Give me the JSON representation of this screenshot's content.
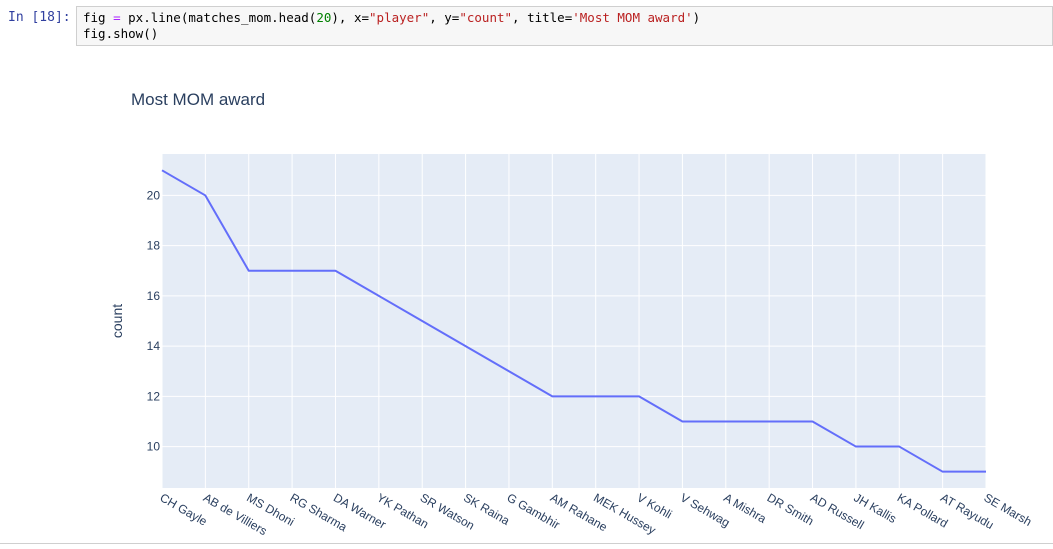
{
  "cell": {
    "prompt": "In [18]:",
    "code": {
      "line1_parts": [
        "fig",
        " = ",
        "px.line(matches_mom.head(",
        "20",
        "), x=",
        "\"player\"",
        ", y=",
        "\"count\"",
        ", title=",
        "'Most MOM award'",
        ")"
      ],
      "line2": "fig.show()"
    }
  },
  "colors": {
    "plot_bg": "#e5ecf6",
    "grid": "#ffffff",
    "line": "#636efa",
    "text": "#2a3f5f",
    "prompt": "#303f9f"
  },
  "chart_data": {
    "type": "line",
    "title": "Most MOM award",
    "xlabel": "",
    "ylabel": "count",
    "x": [
      "CH Gayle",
      "AB de Villiers",
      "MS Dhoni",
      "RG Sharma",
      "DA Warner",
      "YK Pathan",
      "SR Watson",
      "SK Raina",
      "G Gambhir",
      "AM Rahane",
      "MEK Hussey",
      "V Kohli",
      "V Sehwag",
      "A Mishra",
      "DR Smith",
      "AD Russell",
      "JH Kallis",
      "KA Pollard",
      "AT Rayudu",
      "SE Marsh"
    ],
    "y": [
      21,
      20,
      17,
      17,
      17,
      16,
      15,
      14,
      13,
      12,
      12,
      12,
      11,
      11,
      11,
      11,
      10,
      10,
      9,
      9
    ],
    "yticks": [
      10,
      12,
      14,
      16,
      18,
      20
    ],
    "ylim": [
      8.35,
      21.65
    ],
    "grid": true
  }
}
